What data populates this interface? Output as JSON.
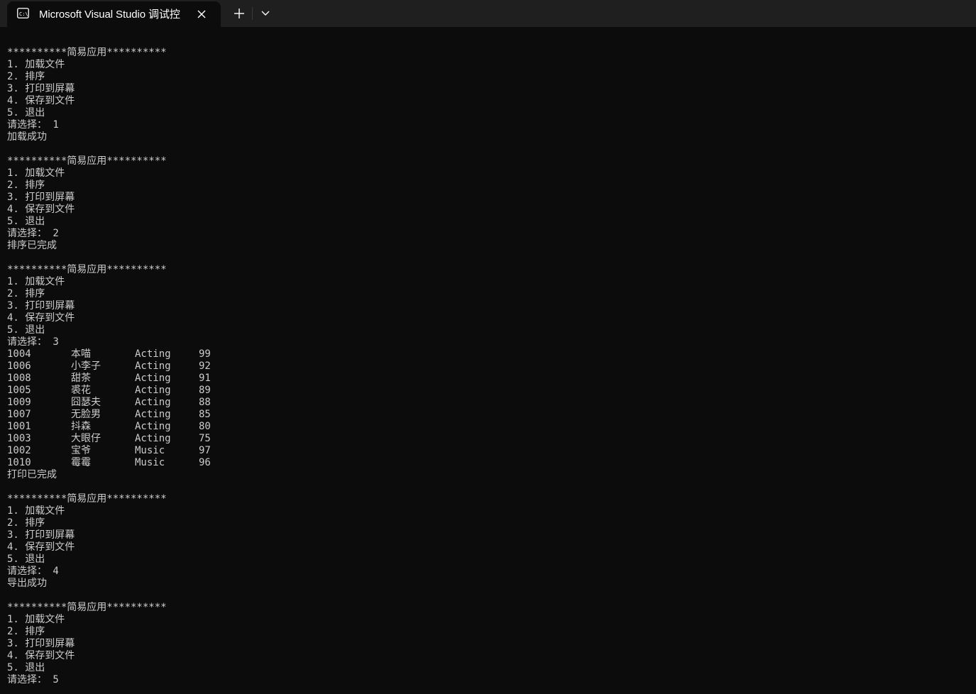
{
  "window": {
    "tab_title": "Microsoft Visual Studio 调试控",
    "tab_icon": "console-icon",
    "close_icon": "close-icon",
    "new_tab_icon": "plus-icon",
    "dropdown_icon": "chevron-down-icon"
  },
  "menu": {
    "header": "**********简易应用**********",
    "items": [
      "1. 加载文件",
      "2. 排序",
      "3. 打印到屏幕",
      "4. 保存到文件",
      "5. 退出"
    ],
    "prompt": "请选择："
  },
  "sessions": [
    {
      "choice": "1",
      "result": "加载成功"
    },
    {
      "choice": "2",
      "result": "排序已完成"
    },
    {
      "choice": "3",
      "result": "打印已完成"
    },
    {
      "choice": "4",
      "result": "导出成功"
    },
    {
      "choice": "5",
      "result": ""
    }
  ],
  "records": [
    {
      "id": "1004",
      "name": "本喵",
      "category": "Acting",
      "score": "99"
    },
    {
      "id": "1006",
      "name": "小李子",
      "category": "Acting",
      "score": "92"
    },
    {
      "id": "1008",
      "name": "甜茶",
      "category": "Acting",
      "score": "91"
    },
    {
      "id": "1005",
      "name": "裘花",
      "category": "Acting",
      "score": "89"
    },
    {
      "id": "1009",
      "name": "囧瑟夫",
      "category": "Acting",
      "score": "88"
    },
    {
      "id": "1007",
      "name": "无脸男",
      "category": "Acting",
      "score": "85"
    },
    {
      "id": "1001",
      "name": "抖森",
      "category": "Acting",
      "score": "80"
    },
    {
      "id": "1003",
      "name": "大眼仔",
      "category": "Acting",
      "score": "75"
    },
    {
      "id": "1002",
      "name": "宝爷",
      "category": "Music",
      "score": "97"
    },
    {
      "id": "1010",
      "name": "霉霉",
      "category": "Music",
      "score": "96"
    }
  ],
  "colors": {
    "background": "#0c0c0c",
    "titlebar": "#1f1f1f",
    "text": "#cccccc"
  }
}
